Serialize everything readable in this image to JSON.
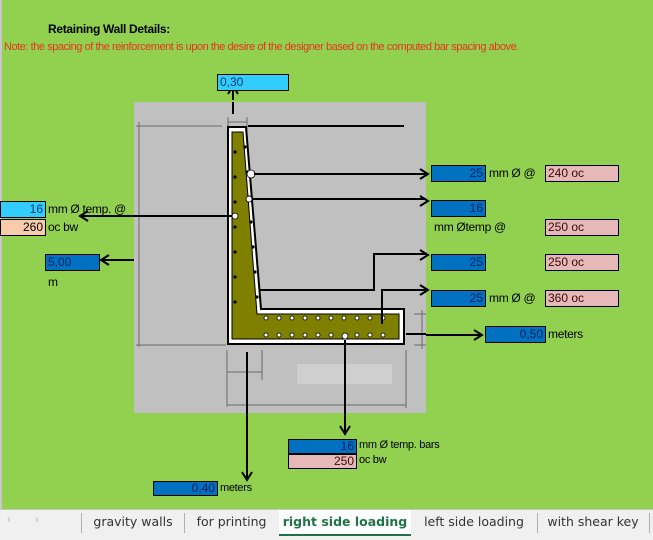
{
  "sheet": {
    "title": "Retaining Wall Details:",
    "note": "Note: the spacing of the reinforcement is upon the desire of the designer based on the computed bar spacing above."
  },
  "cells": {
    "top_thickness": "0,30",
    "stem_main_bar_dia": "25",
    "stem_main_bar_unit": "mm  Ø @",
    "stem_main_spacing": "240 oc",
    "stem_temp_bar_dia": "16",
    "stem_temp_bar_unit": "mm Øtemp @",
    "stem_temp_spacing": "250 oc",
    "heel_top_bar_dia": "25",
    "heel_top_spacing": "250 oc",
    "heel_bottom_bar_dia": "25",
    "heel_bottom_bar_unit": "mm  Ø @",
    "heel_bottom_spacing": "360 oc",
    "base_thickness": "0,50",
    "base_thickness_unit": "meters",
    "left_temp_bar_dia": "16",
    "left_temp_bar_unit": "mm Ø temp. @",
    "left_temp_spacing": "260",
    "left_temp_spacing_unit": "oc bw",
    "wall_height": "5,00",
    "wall_height_unit": "m",
    "footing_temp_bar_dia": "16",
    "footing_temp_bar_unit": "mm Ø temp. bars",
    "footing_temp_spacing": "250",
    "footing_temp_spacing_unit": "oc bw",
    "toe_width": "0,40",
    "toe_width_unit": "meters"
  },
  "tabs": {
    "items": [
      {
        "label": "gravity walls",
        "active": false
      },
      {
        "label": "for printing",
        "active": false
      },
      {
        "label": "right side loading",
        "active": true
      },
      {
        "label": "left side loading",
        "active": false
      },
      {
        "label": "with shear key",
        "active": false
      }
    ],
    "prev_icon": "‹",
    "next_icon": "›"
  },
  "colors": {
    "sheet_bg": "#92d050",
    "note_text": "#e8341c",
    "input_blue": "#0070c0",
    "input_cyan": "#33ccff",
    "output_pink": "#e6b8b7",
    "output_peach": "#f8cbad",
    "concrete_fill": "#808000",
    "active_tab": "#217346"
  }
}
